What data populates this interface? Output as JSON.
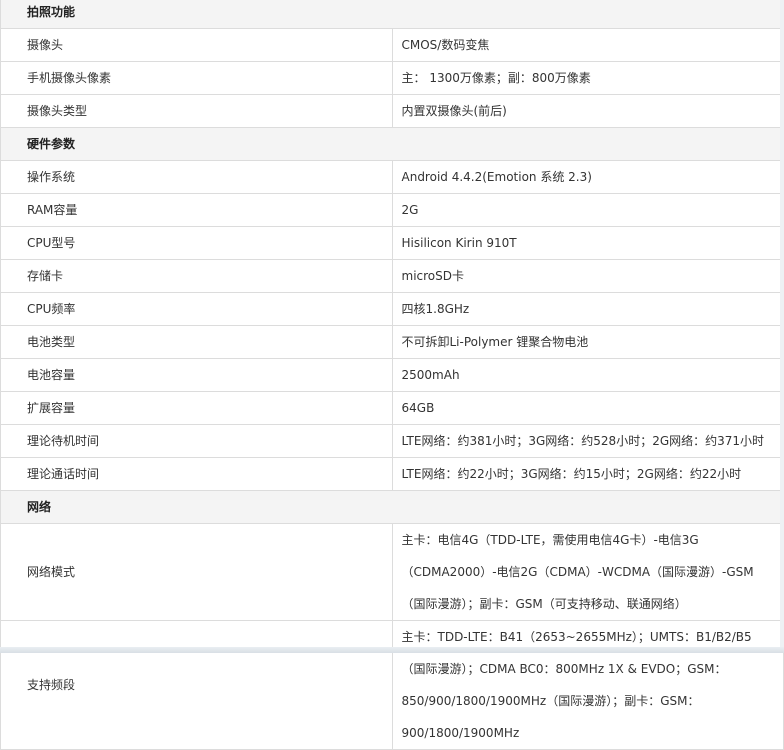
{
  "sections": [
    {
      "title": "拍照功能",
      "rows": [
        {
          "label": "摄像头",
          "value": "CMOS/数码变焦"
        },
        {
          "label": "手机摄像头像素",
          "value": "主： 1300万像素；副：800万像素"
        },
        {
          "label": "摄像头类型",
          "value": "内置双摄像头(前后)"
        }
      ]
    },
    {
      "title": "硬件参数",
      "rows": [
        {
          "label": "操作系统",
          "value": "Android 4.4.2(Emotion 系统 2.3)"
        },
        {
          "label": "RAM容量",
          "value": "2G"
        },
        {
          "label": "CPU型号",
          "value": "Hisilicon Kirin 910T"
        },
        {
          "label": "存储卡",
          "value": "microSD卡"
        },
        {
          "label": "CPU频率",
          "value": "四核1.8GHz"
        },
        {
          "label": "电池类型",
          "value": "不可拆卸Li-Polymer 锂聚合物电池"
        },
        {
          "label": "电池容量",
          "value": "2500mAh"
        },
        {
          "label": "扩展容量",
          "value": "64GB"
        },
        {
          "label": "理论待机时间",
          "value": "LTE网络：约381小时；3G网络：约528小时；2G网络：约371小时"
        },
        {
          "label": "理论通话时间",
          "value": "LTE网络：约22小时；3G网络：约15小时；2G网络：约22小时"
        }
      ]
    },
    {
      "title": "网络",
      "rows": [
        {
          "label": "网络模式",
          "value": "主卡：电信4G（TDD-LTE，需使用电信4G卡）-电信3G（CDMA2000）-电信2G（CDMA）-WCDMA（国际漫游）-GSM（国际漫游）；副卡：GSM（可支持移动、联通网络）"
        },
        {
          "label": "支持频段",
          "value": "主卡：TDD-LTE：B41（2653~2655MHz）；UMTS：B1/B2/B5（国际漫游）；CDMA BC0：800MHz 1X & EVDO；GSM：850/900/1800/1900MHz（国际漫游）；副卡：GSM：900/1800/1900MHz"
        }
      ]
    }
  ]
}
